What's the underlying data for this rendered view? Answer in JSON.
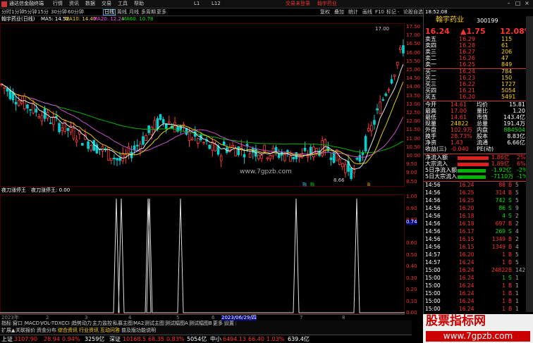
{
  "app": {
    "title": "通达信金融终端",
    "menus": [
      "行情",
      "资讯",
      "数据",
      "交易",
      "工具",
      "帮助",
      "L1",
      "L12"
    ],
    "promo": [
      "交易未登录",
      "翰宇药业"
    ]
  },
  "period_tabs": [
    "分时",
    "1分钟",
    "5分钟",
    "15分",
    "30分钟",
    "60分钟",
    "日线",
    "周线",
    "月线",
    "多周期",
    "更多"
  ],
  "period_selected": "日线",
  "right_tools": [
    "复权",
    "叠加",
    "统计",
    "画线",
    "F10",
    "标记",
    "-",
    "论股",
    "自选",
    "+"
  ],
  "stock_header": {
    "name": "翰宇药业(日线)",
    "ma5": "MA5: 14.52",
    "ma10": "MA10: 14.40",
    "ma20": "MA20: 12.24",
    "ma60": "MA60: 10.78"
  },
  "price_axis": [
    "17.50",
    "17.00",
    "16.50",
    "16.00",
    "15.50",
    "15.00",
    "14.50",
    "14.00",
    "13.50",
    "13.00",
    "12.50",
    "12.00",
    "11.50",
    "11.00",
    "10.50",
    "10.00",
    "9.50",
    "9.00",
    "8.50"
  ],
  "annotations": {
    "high": "17.00",
    "low": "8.66",
    "watermark": "www.7gpzb.com",
    "markers": [
      "融",
      "融",
      "B"
    ]
  },
  "indicator": {
    "title": "夜刀涨停王",
    "subtitle": "夜刀涨停王: 0.00",
    "axis": [
      "1.00",
      "0.90",
      "0.80",
      "0.74",
      "0.60",
      "0.50",
      "0.40",
      "0.30",
      "0.20",
      "0.10",
      "0.00"
    ]
  },
  "date_axis": [
    "2023年",
    "2",
    "3",
    "4",
    "5",
    "6",
    "2023/06/29/四",
    "7",
    "8"
  ],
  "indicator_tabs": [
    "指标",
    "窗口",
    "MACD",
    "VOL-TDX",
    "CCI",
    "趋势动力",
    "主力监控",
    "私募主图",
    "MA2",
    "测试主图",
    "测试幅图A",
    "测试幅图B",
    "更多",
    "设置"
  ],
  "sub_tabs": [
    "扩展▲",
    "关联报价",
    "资金分布",
    "综合资讯",
    "行业资讯",
    "互动问答",
    "普及版功能说明"
  ],
  "status": {
    "sh_label": "上证",
    "sh_val": "3107.90",
    "sh_chg": "28.94",
    "sh_pct": "0.94%",
    "sh_amt": "3259亿",
    "sz_label": "深证",
    "sz_val": "10168.5",
    "sz_chg": "68.35",
    "sz_pct": "0.83%",
    "sz_amt": "5054亿",
    "zx_label": "中小",
    "zx_val": "6494.13",
    "zx_chg": "66.40",
    "zx_pct": "1.03%",
    "zx_amt": "639.4亿"
  },
  "panel": {
    "title": "翰宇药业",
    "code": "300199",
    "price": "16.24",
    "change": "▲1.75",
    "pct": "12.08%",
    "asks": [
      {
        "label": "卖五",
        "price": "16.29",
        "vol": "115"
      },
      {
        "label": "卖四",
        "price": "16.28",
        "vol": "61"
      },
      {
        "label": "卖三",
        "price": "16.27",
        "vol": "206"
      },
      {
        "label": "卖二",
        "price": "16.26",
        "vol": "47"
      },
      {
        "label": "卖一",
        "price": "16.25",
        "vol": "849"
      }
    ],
    "bids": [
      {
        "label": "买一",
        "price": "16.24",
        "vol": "784"
      },
      {
        "label": "买二",
        "price": "16.23",
        "vol": "150"
      },
      {
        "label": "买三",
        "price": "16.22",
        "vol": "1727"
      },
      {
        "label": "买四",
        "price": "16.21",
        "vol": "5054"
      },
      {
        "label": "买五",
        "price": "16.20",
        "vol": "5491"
      }
    ],
    "stats": [
      {
        "l1": "今开",
        "v1": "14.61",
        "l2": "均价",
        "v2": "15.81"
      },
      {
        "l1": "最高",
        "v1": "17.00",
        "l2": "量比",
        "v2": "1.20"
      },
      {
        "l1": "最低",
        "v1": "14.61",
        "l2": "市值",
        "v2": "143.4亿"
      },
      {
        "l1": "现量",
        "v1": "24822",
        "l2": "总量",
        "v2": "191.4万"
      },
      {
        "l1": "外盘",
        "v1": "102.9万",
        "l2": "内盘",
        "v2": "884504"
      },
      {
        "l1": "换手",
        "v1": "28.73%",
        "l2": "股本",
        "v2": "8.83亿"
      },
      {
        "l1": "净资",
        "v1": "1.43",
        "l2": "流通",
        "v2": "6.66亿"
      },
      {
        "l1": "收益(三)",
        "v1": "-0.040",
        "l2": "PE(动)",
        "v2": ""
      }
    ],
    "flows": [
      {
        "label": "净流入额",
        "val": "1.86亿",
        "pct": "2%"
      },
      {
        "label": "大宗流入",
        "val": "1.89亿",
        "pct": "6%"
      },
      {
        "label": "5日净流入额",
        "val": "-1.92亿",
        "pct": "-2%"
      },
      {
        "label": "5日大宗流入",
        "val": "-7110万",
        "pct": "-1%"
      }
    ],
    "ticks": [
      {
        "t": "14:56",
        "p": "16.24",
        "v": "88",
        "s": "B",
        "n": "5"
      },
      {
        "t": "14:56",
        "p": "16.25",
        "v": "314",
        "s": "B",
        "n": "5"
      },
      {
        "t": "14:56",
        "p": "16.25",
        "v": "742",
        "s": "S",
        "n": "5"
      },
      {
        "t": "14:56",
        "p": "16.20",
        "v": "86",
        "s": "S",
        "n": "9"
      },
      {
        "t": "14:56",
        "p": "16.18",
        "v": "4",
        "s": "S",
        "n": "2"
      },
      {
        "t": "14:56",
        "p": "16.18",
        "v": "697",
        "s": "B",
        "n": "2"
      },
      {
        "t": "14:56",
        "p": "16.17",
        "v": "269",
        "s": "S",
        "n": "4"
      },
      {
        "t": "14:56",
        "p": "16.15",
        "v": "1349",
        "s": "B",
        "n": "2"
      },
      {
        "t": "14:56",
        "p": "16.15",
        "v": "1349",
        "s": "B",
        "n": "4"
      },
      {
        "t": "14:57",
        "p": "16.20",
        "v": "1",
        "s": "B",
        "n": "5"
      },
      {
        "t": "14:57",
        "p": "16.24",
        "v": "1",
        "s": "B",
        "n": "5"
      },
      {
        "t": "15:00",
        "p": "16.24",
        "v": "24822",
        "s": "B",
        "n": "1426"
      },
      {
        "t": "15:00",
        "p": "16.24",
        "v": "1",
        "s": "S",
        "n": "1"
      },
      {
        "t": "15:00",
        "p": "16.24",
        "v": "1",
        "s": "B",
        "n": "1"
      },
      {
        "t": "15:00",
        "p": "16.24",
        "v": "1",
        "s": "B",
        "n": "1"
      },
      {
        "t": "15:00",
        "p": "16.24",
        "v": "1",
        "s": "B",
        "n": "1"
      },
      {
        "t": "15:00",
        "p": "16.24",
        "v": "1",
        "s": "B",
        "n": "1"
      }
    ]
  },
  "clock": "18:52:08",
  "tabbar_right": [
    "分时",
    "明细",
    "分价",
    "笔"
  ],
  "watermark2": {
    "line1": "股票指标网",
    "line2": "www.7gpzb.com"
  }
}
